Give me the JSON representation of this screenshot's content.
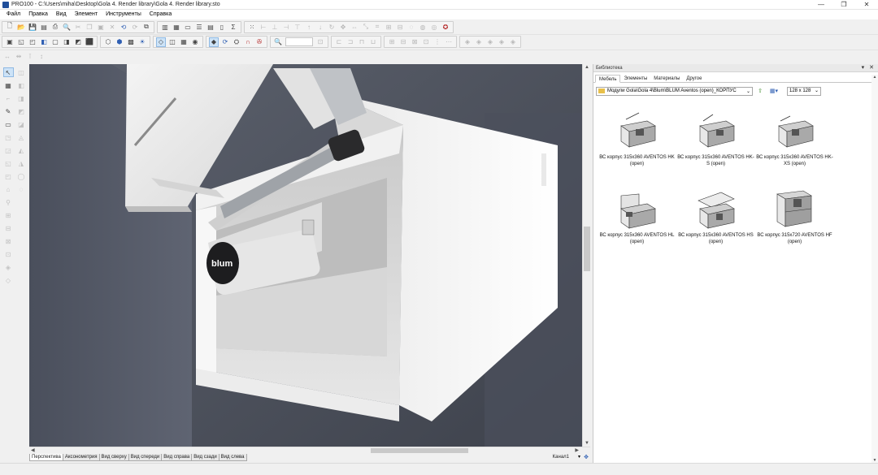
{
  "window": {
    "title": "PRO100 - C:\\Users\\miha\\Desktop\\Gola 4. Render library\\Gola 4. Render library.sto",
    "controls": [
      "—",
      "❐",
      "✕"
    ]
  },
  "menu": [
    "Файл",
    "Правка",
    "Вид",
    "Элемент",
    "Инструменты",
    "Справка"
  ],
  "viewport": {
    "brand_text": "blum"
  },
  "view_tabs": [
    "Перспектива",
    "Аксонометрия",
    "Вид сверху",
    "Вид спереди",
    "Вид справа",
    "Вид сзади",
    "Вид слева"
  ],
  "channel": "Канал1",
  "library": {
    "title": "Библиотека",
    "panel_controls": "▾ ✕",
    "tabs": [
      "Мебель",
      "Элементы",
      "Материалы",
      "Другое"
    ],
    "path": "Модули Gola\\Gola 4\\Blum\\BLUM Aventos (open)_КОРПУС",
    "size": "128 x 128",
    "items": [
      {
        "label": "ВС корпус 315x360 AVENTOS HK (open)"
      },
      {
        "label": "ВС корпус 315x360 AVENTOS HK-S (open)"
      },
      {
        "label": "ВС корпус 315x360 AVENTOS HK-XS (open)"
      },
      {
        "label": "ВС корпус 315x360 AVENTOS HL (open)"
      },
      {
        "label": "ВС корпус 315x360 AVENTOS HS (open)"
      },
      {
        "label": "ВС корпус 315x720 AVENTOS HF (open)"
      }
    ]
  }
}
